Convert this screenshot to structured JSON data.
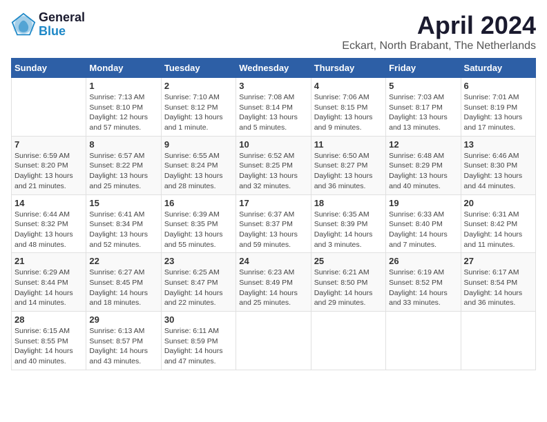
{
  "logo": {
    "text1": "General",
    "text2": "Blue"
  },
  "title": "April 2024",
  "subtitle": "Eckart, North Brabant, The Netherlands",
  "days_of_week": [
    "Sunday",
    "Monday",
    "Tuesday",
    "Wednesday",
    "Thursday",
    "Friday",
    "Saturday"
  ],
  "weeks": [
    [
      {
        "day": "",
        "info": ""
      },
      {
        "day": "1",
        "info": "Sunrise: 7:13 AM\nSunset: 8:10 PM\nDaylight: 12 hours\nand 57 minutes."
      },
      {
        "day": "2",
        "info": "Sunrise: 7:10 AM\nSunset: 8:12 PM\nDaylight: 13 hours\nand 1 minute."
      },
      {
        "day": "3",
        "info": "Sunrise: 7:08 AM\nSunset: 8:14 PM\nDaylight: 13 hours\nand 5 minutes."
      },
      {
        "day": "4",
        "info": "Sunrise: 7:06 AM\nSunset: 8:15 PM\nDaylight: 13 hours\nand 9 minutes."
      },
      {
        "day": "5",
        "info": "Sunrise: 7:03 AM\nSunset: 8:17 PM\nDaylight: 13 hours\nand 13 minutes."
      },
      {
        "day": "6",
        "info": "Sunrise: 7:01 AM\nSunset: 8:19 PM\nDaylight: 13 hours\nand 17 minutes."
      }
    ],
    [
      {
        "day": "7",
        "info": "Sunrise: 6:59 AM\nSunset: 8:20 PM\nDaylight: 13 hours\nand 21 minutes."
      },
      {
        "day": "8",
        "info": "Sunrise: 6:57 AM\nSunset: 8:22 PM\nDaylight: 13 hours\nand 25 minutes."
      },
      {
        "day": "9",
        "info": "Sunrise: 6:55 AM\nSunset: 8:24 PM\nDaylight: 13 hours\nand 28 minutes."
      },
      {
        "day": "10",
        "info": "Sunrise: 6:52 AM\nSunset: 8:25 PM\nDaylight: 13 hours\nand 32 minutes."
      },
      {
        "day": "11",
        "info": "Sunrise: 6:50 AM\nSunset: 8:27 PM\nDaylight: 13 hours\nand 36 minutes."
      },
      {
        "day": "12",
        "info": "Sunrise: 6:48 AM\nSunset: 8:29 PM\nDaylight: 13 hours\nand 40 minutes."
      },
      {
        "day": "13",
        "info": "Sunrise: 6:46 AM\nSunset: 8:30 PM\nDaylight: 13 hours\nand 44 minutes."
      }
    ],
    [
      {
        "day": "14",
        "info": "Sunrise: 6:44 AM\nSunset: 8:32 PM\nDaylight: 13 hours\nand 48 minutes."
      },
      {
        "day": "15",
        "info": "Sunrise: 6:41 AM\nSunset: 8:34 PM\nDaylight: 13 hours\nand 52 minutes."
      },
      {
        "day": "16",
        "info": "Sunrise: 6:39 AM\nSunset: 8:35 PM\nDaylight: 13 hours\nand 55 minutes."
      },
      {
        "day": "17",
        "info": "Sunrise: 6:37 AM\nSunset: 8:37 PM\nDaylight: 13 hours\nand 59 minutes."
      },
      {
        "day": "18",
        "info": "Sunrise: 6:35 AM\nSunset: 8:39 PM\nDaylight: 14 hours\nand 3 minutes."
      },
      {
        "day": "19",
        "info": "Sunrise: 6:33 AM\nSunset: 8:40 PM\nDaylight: 14 hours\nand 7 minutes."
      },
      {
        "day": "20",
        "info": "Sunrise: 6:31 AM\nSunset: 8:42 PM\nDaylight: 14 hours\nand 11 minutes."
      }
    ],
    [
      {
        "day": "21",
        "info": "Sunrise: 6:29 AM\nSunset: 8:44 PM\nDaylight: 14 hours\nand 14 minutes."
      },
      {
        "day": "22",
        "info": "Sunrise: 6:27 AM\nSunset: 8:45 PM\nDaylight: 14 hours\nand 18 minutes."
      },
      {
        "day": "23",
        "info": "Sunrise: 6:25 AM\nSunset: 8:47 PM\nDaylight: 14 hours\nand 22 minutes."
      },
      {
        "day": "24",
        "info": "Sunrise: 6:23 AM\nSunset: 8:49 PM\nDaylight: 14 hours\nand 25 minutes."
      },
      {
        "day": "25",
        "info": "Sunrise: 6:21 AM\nSunset: 8:50 PM\nDaylight: 14 hours\nand 29 minutes."
      },
      {
        "day": "26",
        "info": "Sunrise: 6:19 AM\nSunset: 8:52 PM\nDaylight: 14 hours\nand 33 minutes."
      },
      {
        "day": "27",
        "info": "Sunrise: 6:17 AM\nSunset: 8:54 PM\nDaylight: 14 hours\nand 36 minutes."
      }
    ],
    [
      {
        "day": "28",
        "info": "Sunrise: 6:15 AM\nSunset: 8:55 PM\nDaylight: 14 hours\nand 40 minutes."
      },
      {
        "day": "29",
        "info": "Sunrise: 6:13 AM\nSunset: 8:57 PM\nDaylight: 14 hours\nand 43 minutes."
      },
      {
        "day": "30",
        "info": "Sunrise: 6:11 AM\nSunset: 8:59 PM\nDaylight: 14 hours\nand 47 minutes."
      },
      {
        "day": "",
        "info": ""
      },
      {
        "day": "",
        "info": ""
      },
      {
        "day": "",
        "info": ""
      },
      {
        "day": "",
        "info": ""
      }
    ]
  ]
}
